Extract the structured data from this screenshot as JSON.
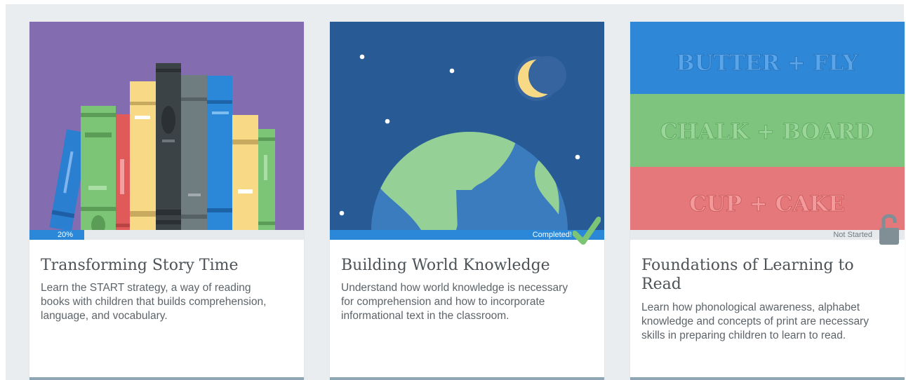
{
  "cards": [
    {
      "title": "Transforming Story Time",
      "description": "Learn the START strategy, a way of reading books with children that builds comprehension, language, and vocabulary.",
      "progress_label": "20%",
      "progress_fraction": 0.2,
      "art": "books-shelf"
    },
    {
      "title": "Building World Knowledge",
      "description": "Understand how world knowledge is necessary for comprehension and how to incorporate informational text in the classroom.",
      "status_label": "Completed!",
      "progress_fraction": 1.0,
      "art": "earth-night-sky",
      "status_icon": "check-icon"
    },
    {
      "title": "Foundations of Learning to Read",
      "description": "Learn how phonological awareness, alphabet knowledge and concepts of print are necessary skills in preparing children to learn to read.",
      "status_label": "Not Started",
      "progress_fraction": 0,
      "art": "compound-words",
      "status_icon": "unlocked-padlock-icon",
      "art_words": [
        "BUTTER + FLY",
        "CHALK + BOARD",
        "CUP + CAKE"
      ]
    }
  ],
  "colors": {
    "page_background": "#e9edf0",
    "progress_blue": "#2b87d8",
    "check_green": "#7cc576",
    "purple_art_bg": "#836db0",
    "night_sky_bg": "#285a95",
    "band_blue": "#2f87d7",
    "band_green": "#7ec47e",
    "band_red": "#e5787a"
  }
}
